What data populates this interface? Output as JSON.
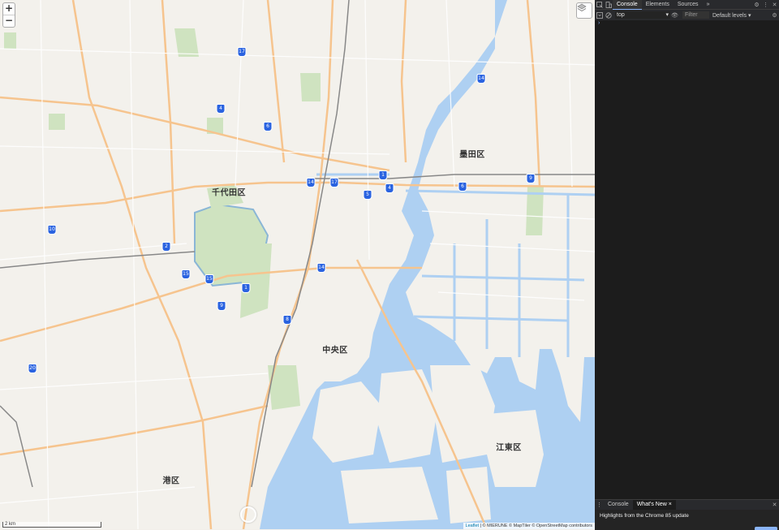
{
  "map": {
    "zoom_in": "+",
    "zoom_out": "−",
    "scale_label": "2 km",
    "attribution": {
      "leaflet": "Leaflet",
      "rest": " | © MIERUNE © MapTiler © OpenStreetMap contributors"
    },
    "labels": [
      {
        "name": "chiyoda",
        "text": "千代田区"
      },
      {
        "name": "chuo",
        "text": "中央区"
      },
      {
        "name": "sumida",
        "text": "墨田区"
      },
      {
        "name": "koto",
        "text": "江東区"
      },
      {
        "name": "minato",
        "text": "港区"
      }
    ],
    "shields": [
      "17",
      "4",
      "6",
      "14",
      "17",
      "5",
      "1",
      "4",
      "14",
      "6",
      "9",
      "10",
      "2",
      "15",
      "15",
      "1",
      "9",
      "14",
      "8",
      "20"
    ]
  },
  "devtools": {
    "tabs": [
      "Console",
      "Elements",
      "Sources"
    ],
    "more": "»",
    "context": "top",
    "filter_placeholder": "Filter",
    "levels": "Default levels ▾",
    "prompt": "›",
    "drawer_tabs": [
      "Console",
      "What's New"
    ],
    "drawer_close": "×",
    "highlights": "Highlights from the Chrome 85 update"
  }
}
